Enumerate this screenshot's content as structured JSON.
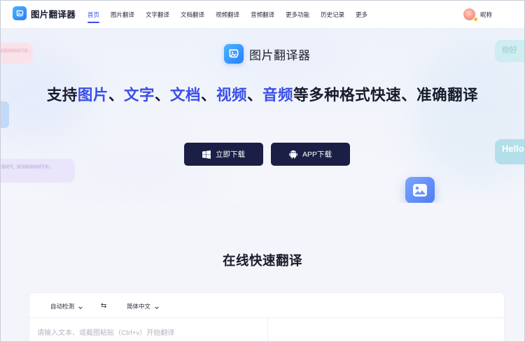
{
  "nav": {
    "logo_text": "图片翻译器",
    "links": [
      {
        "label": "首页",
        "active": true
      },
      {
        "label": "图片翻译"
      },
      {
        "label": "文字翻译"
      },
      {
        "label": "文档翻译"
      },
      {
        "label": "视频翻译"
      },
      {
        "label": "音频翻译"
      },
      {
        "label": "更多功能"
      },
      {
        "label": "历史记录"
      },
      {
        "label": "更多"
      }
    ],
    "user_name": "昵称"
  },
  "hero": {
    "brand_text": "图片翻译器",
    "headline": {
      "prefix": "支持",
      "image": "图片",
      "sep1": "、",
      "text": "文字",
      "sep2": "、",
      "document": "文档",
      "sep3": "、",
      "video": "视频",
      "sep4": "、",
      "audio": "音频",
      "suffix": "等多种格式快速、准确翻译"
    },
    "buttons": {
      "windows_download": "立即下载",
      "app_download": "APP下载"
    },
    "bubbles": {
      "left_top": "ввините.",
      "left_bottom": "свет, извините.",
      "right_top": "你好",
      "right_mid": "Hello"
    }
  },
  "section": {
    "title": "在线快速翻译",
    "source_language": "自动检测",
    "swap_symbol": "⇆",
    "target_language": "简体中文",
    "input_placeholder": "请输入文本、或截图粘贴（Ctrl+v）开始翻译"
  },
  "colors": {
    "accent": "#3a4ee8",
    "button_bg": "#1b1f45",
    "logo_blue": "#2a7dff"
  },
  "icons": {
    "logo": "image-translate-logo-icon",
    "windows": "windows-icon",
    "android": "android-icon",
    "image_float": "image-icon",
    "chevron": "chevron-down-icon",
    "swap": "swap-icon"
  }
}
